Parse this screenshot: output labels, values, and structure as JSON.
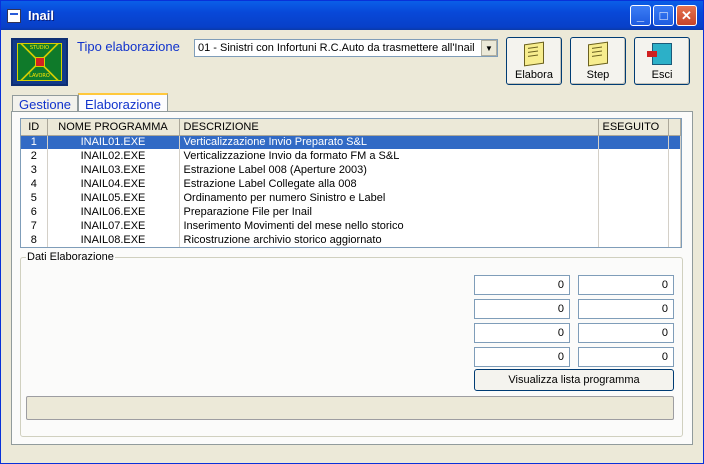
{
  "window": {
    "title": "Inail"
  },
  "logo": {
    "top_text": "STUDIO",
    "bottom_text": "LAVORO"
  },
  "header": {
    "tipo_label": "Tipo elaborazione",
    "tipo_value": "01 - Sinistri con Infortuni R.C.Auto da trasmettere all'Inail"
  },
  "toolbar": {
    "elabora": "Elabora",
    "step": "Step",
    "esci": "Esci"
  },
  "tabs": [
    {
      "label": "Gestione",
      "active": false
    },
    {
      "label": "Elaborazione",
      "active": true
    }
  ],
  "grid": {
    "columns": [
      "ID",
      "NOME PROGRAMMA",
      "DESCRIZIONE",
      "ESEGUITO"
    ],
    "rows": [
      {
        "id": "1",
        "nome": "INAIL01.EXE",
        "desc": "Verticalizzazione Invio Preparato S&L",
        "eseguito": ""
      },
      {
        "id": "2",
        "nome": "INAIL02.EXE",
        "desc": "Verticalizzazione Invio da formato FM a S&L",
        "eseguito": ""
      },
      {
        "id": "3",
        "nome": "INAIL03.EXE",
        "desc": "Estrazione Label 008  (Aperture 2003)",
        "eseguito": ""
      },
      {
        "id": "4",
        "nome": "INAIL04.EXE",
        "desc": "Estrazione Label Collegate alla 008",
        "eseguito": ""
      },
      {
        "id": "5",
        "nome": "INAIL05.EXE",
        "desc": "Ordinamento per numero Sinistro e Label",
        "eseguito": ""
      },
      {
        "id": "6",
        "nome": "INAIL06.EXE",
        "desc": "Preparazione File per Inail",
        "eseguito": ""
      },
      {
        "id": "7",
        "nome": "INAIL07.EXE",
        "desc": "Inserimento Movimenti del mese nello storico",
        "eseguito": ""
      },
      {
        "id": "8",
        "nome": "INAIL08.EXE",
        "desc": "Ricostruzione archivio storico aggiornato",
        "eseguito": ""
      }
    ],
    "selected_index": 0
  },
  "dati": {
    "legend": "Dati Elaborazione",
    "values": [
      "0",
      "0",
      "0",
      "0",
      "0",
      "0",
      "0",
      "0"
    ],
    "button": "Visualizza lista programma"
  },
  "colors": {
    "selection": "#316ac5",
    "tab_text": "#1133cc"
  }
}
